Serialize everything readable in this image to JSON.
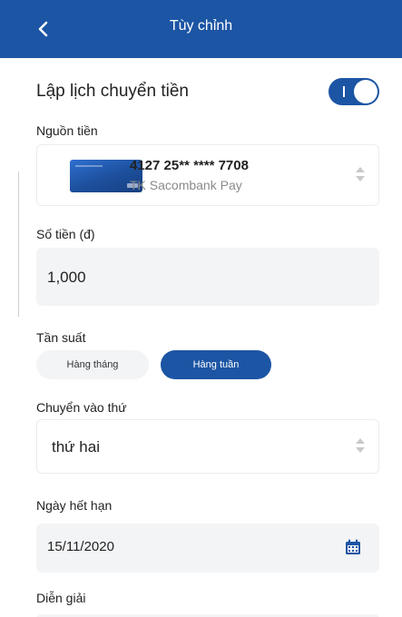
{
  "header": {
    "title": "Tùy chỉnh",
    "back_icon": "chevron-left-icon",
    "color": "#1c55a4"
  },
  "schedule": {
    "label": "Lập lịch chuyển tiền",
    "enabled": true
  },
  "source": {
    "label": "Nguồn tiền",
    "card_number": "4127 25** **** 7708",
    "account_name": "TK Sacombank Pay"
  },
  "amount": {
    "label": "Số tiền (đ)",
    "value": "1,000"
  },
  "frequency": {
    "label": "Tần suất",
    "options": [
      "Hàng tháng",
      "Hàng tuần"
    ],
    "selected": "Hàng tuần"
  },
  "transfer_day": {
    "label": "Chuyển vào thứ",
    "value": "thứ hai"
  },
  "expiry": {
    "label": "Ngày hết hạn",
    "value": "15/11/2020",
    "icon": "calendar-icon"
  },
  "description": {
    "label": "Diễn giải"
  },
  "colors": {
    "accent": "#1c55a4",
    "field_bg": "#f3f4f6"
  }
}
